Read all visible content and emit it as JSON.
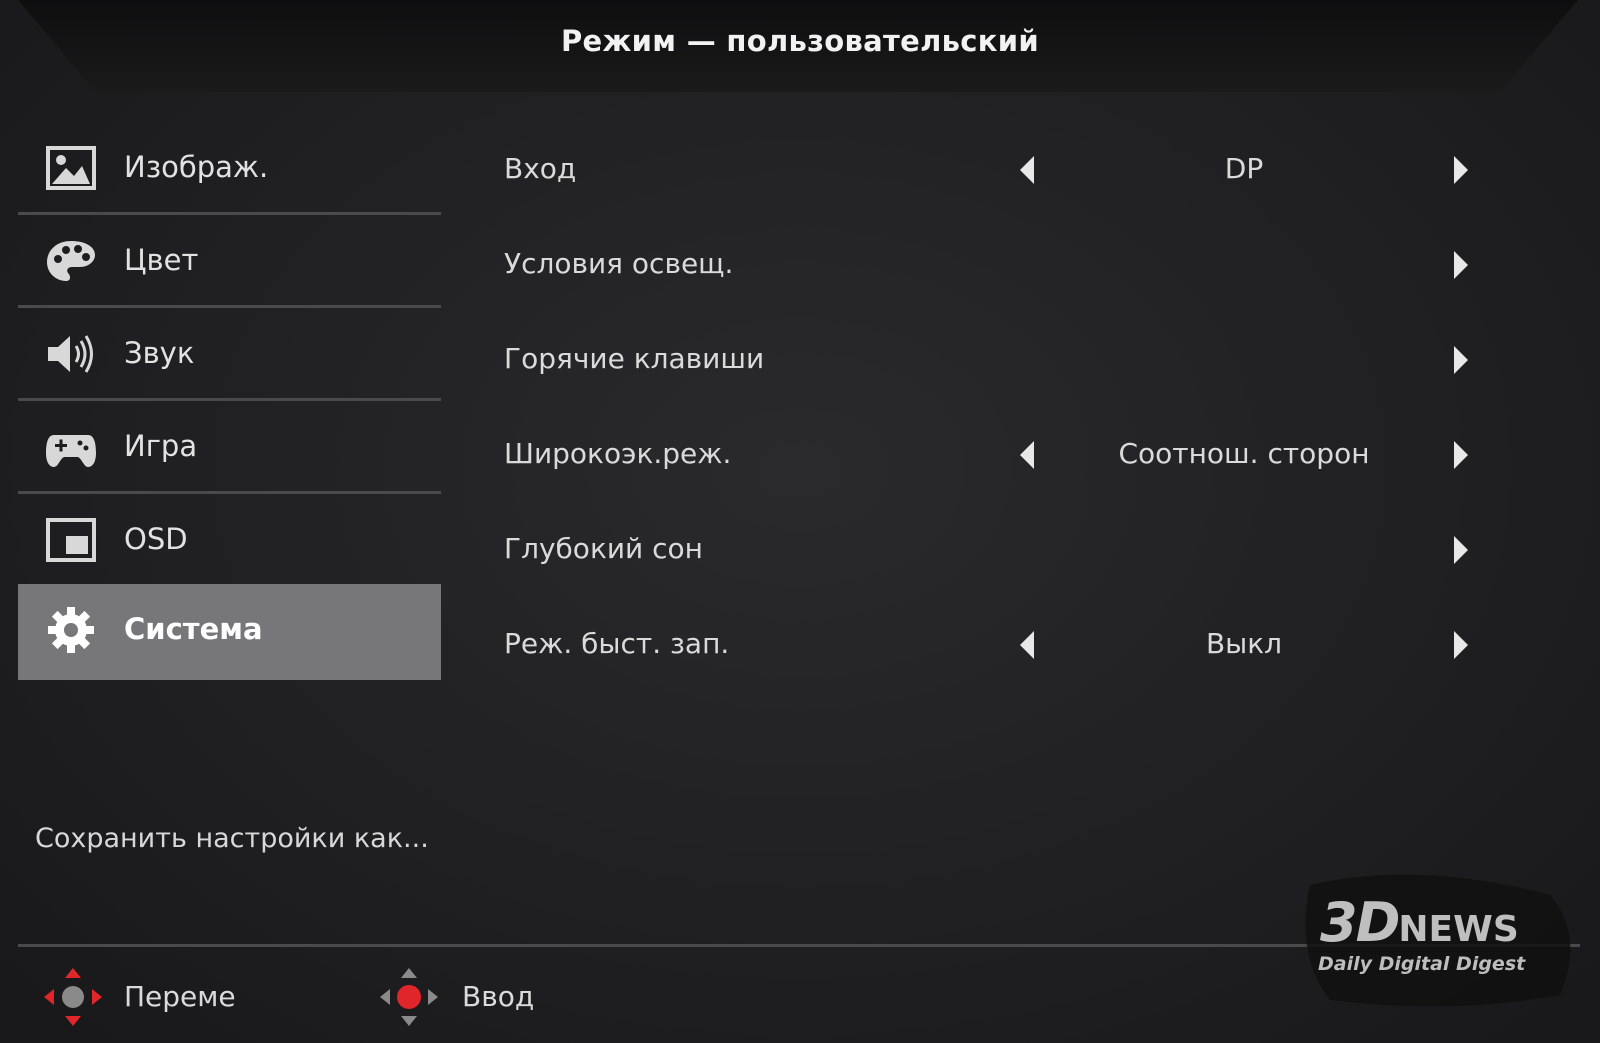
{
  "header": {
    "title": "Режим — пользовательский"
  },
  "sidebar": {
    "items": [
      {
        "label": "Изображ.",
        "icon": "image-icon",
        "active": false
      },
      {
        "label": "Цвет",
        "icon": "palette-icon",
        "active": false
      },
      {
        "label": "Звук",
        "icon": "speaker-icon",
        "active": false
      },
      {
        "label": "Игра",
        "icon": "gamepad-icon",
        "active": false
      },
      {
        "label": "OSD",
        "icon": "osd-icon",
        "active": false
      },
      {
        "label": "Система",
        "icon": "gear-icon",
        "active": true
      }
    ],
    "save_as": "Сохранить настройки как..."
  },
  "settings": {
    "rows": [
      {
        "label": "Вход",
        "value": "DP",
        "has_left_arrow": true
      },
      {
        "label": "Условия освещ.",
        "value": "",
        "has_left_arrow": false
      },
      {
        "label": "Горячие клавиши",
        "value": "",
        "has_left_arrow": false
      },
      {
        "label": "Широкоэк.реж.",
        "value": "Соотнош. сторон",
        "has_left_arrow": true
      },
      {
        "label": "Глубокий сон",
        "value": "",
        "has_left_arrow": false
      },
      {
        "label": "Реж. быст. зап.",
        "value": "Выкл",
        "has_left_arrow": true
      }
    ]
  },
  "footer": {
    "move_label": "Переме",
    "enter_label": "Ввод"
  },
  "watermark": {
    "logo_main": "3D",
    "logo_news": "NEWS",
    "tagline": "Daily Digital Digest"
  },
  "colors": {
    "background": "#1d1d1f",
    "active_item": "#77777a",
    "divider": "#4a4a4c",
    "nav_red": "#e0262a"
  }
}
